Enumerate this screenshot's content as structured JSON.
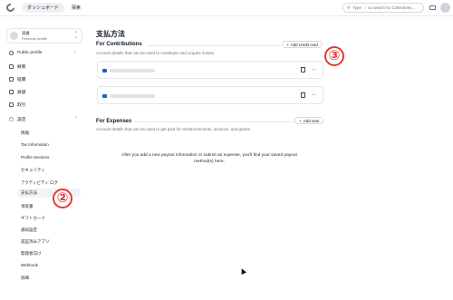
{
  "topbar": {
    "dashboard_label": "ダッシュボード",
    "explore_label": "探索",
    "search_key": "/",
    "search_placeholder": "to search for Collectives..."
  },
  "sidebar": {
    "profile_name": "貝倉",
    "profile_type": "Personal profile",
    "public_profile": "Public profile",
    "items": [
      {
        "label": "概要"
      },
      {
        "label": "経費"
      },
      {
        "label": "貢献"
      },
      {
        "label": "取引"
      },
      {
        "label": "設定"
      }
    ],
    "settings_items": [
      {
        "label": "情報"
      },
      {
        "label": "Tax Information"
      },
      {
        "label": "Profile Sections"
      },
      {
        "label": "セキュリティ"
      },
      {
        "label": "アクティビティ ログ"
      },
      {
        "label": "支払方法"
      },
      {
        "label": "領収書"
      },
      {
        "label": "ギフトカード"
      },
      {
        "label": "通知設定"
      },
      {
        "label": "認証済みアプリ"
      },
      {
        "label": "開発者向け"
      },
      {
        "label": "Webhook"
      },
      {
        "label": "詳細"
      }
    ]
  },
  "main": {
    "title": "支払方法",
    "contributions": {
      "title": "For Contributions",
      "description": "Account details that can be used to contribute and acquire tickets.",
      "add_button": "Add credit card"
    },
    "expenses": {
      "title": "For Expenses",
      "description": "Account details that can be used to get paid for reimbursements, invoices, and grants.",
      "add_button": "Add new",
      "empty_message": "After you add a new payout information or submit an expense, you'll find your saved payout method(s) here."
    }
  },
  "annotations": {
    "badge_2": "②",
    "badge_3": "③"
  },
  "colors": {
    "annotation": "#e53935",
    "card_brand": "#1565c0"
  }
}
